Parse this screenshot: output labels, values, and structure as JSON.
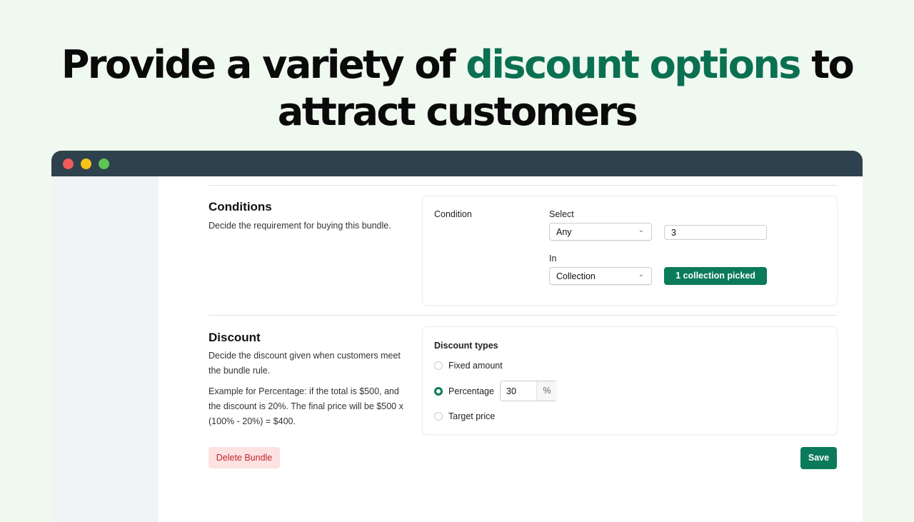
{
  "hero": {
    "line1_pre": "Provide a variety of ",
    "line1_accent": "discount options",
    "line1_post": " to",
    "line2": "attract customers"
  },
  "colors": {
    "accent": "#0b7052",
    "primary_button": "#0b7a5a",
    "titlebar": "#2e424d"
  },
  "conditions": {
    "title": "Conditions",
    "description": "Decide the requirement for buying this bundle.",
    "condition_label": "Condition",
    "select_label": "Select",
    "select_value": "Any",
    "quantity_value": "3",
    "in_label": "In",
    "in_value": "Collection",
    "picked_button": "1 collection picked"
  },
  "discount": {
    "title": "Discount",
    "description": "Decide the discount given when customers meet the bundle rule.",
    "example": "Example for Percentage: if the total is $500, and the discount is 20%. The final price will be $500 x (100% - 20%) = $400.",
    "types_label": "Discount types",
    "options": [
      {
        "label": "Fixed amount",
        "selected": false
      },
      {
        "label": "Percentage",
        "selected": true
      },
      {
        "label": "Target price",
        "selected": false
      }
    ],
    "percentage_value": "30",
    "percent_suffix": "%"
  },
  "actions": {
    "delete": "Delete Bundle",
    "save": "Save"
  }
}
